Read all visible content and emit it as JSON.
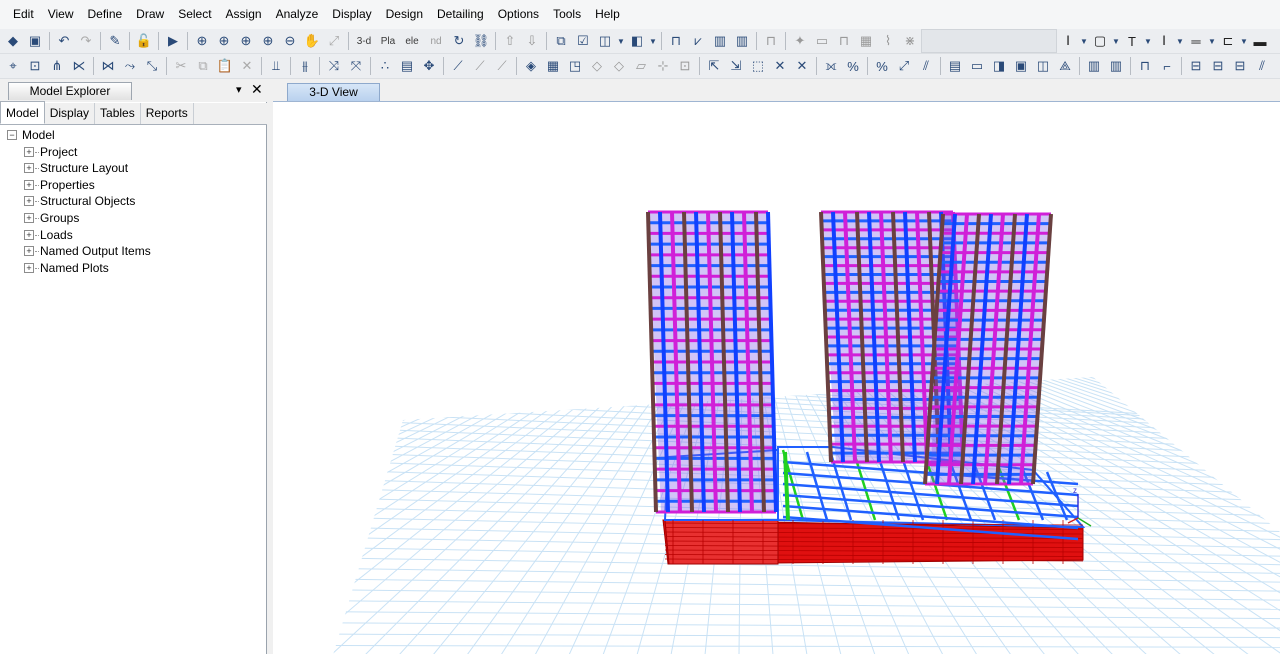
{
  "menu": [
    "Edit",
    "View",
    "Define",
    "Draw",
    "Select",
    "Assign",
    "Analyze",
    "Display",
    "Design",
    "Detailing",
    "Options",
    "Tools",
    "Help"
  ],
  "toolbar": {
    "view_3d_label": "3-d",
    "plan_label": "Pla",
    "elevation_label": "ele",
    "nd_label": "nd"
  },
  "explorer": {
    "title": "Model Explorer",
    "pin_glyph": "▾",
    "close_glyph": "✕",
    "tabs": [
      "Model",
      "Display",
      "Tables",
      "Reports"
    ],
    "root": "Model",
    "items": [
      "Project",
      "Structure Layout",
      "Properties",
      "Structural Objects",
      "Groups",
      "Loads",
      "Named Output Items",
      "Named Plots"
    ]
  },
  "viewer": {
    "tab_label": "3-D View",
    "axis_label": "z"
  },
  "colors": {
    "grid": "#c9e2f5",
    "frame_blue": "#2060ff",
    "frame_magenta": "#d020d8",
    "base_red": "#e01010",
    "green_member": "#20d020"
  }
}
